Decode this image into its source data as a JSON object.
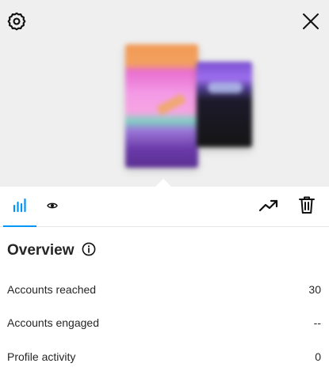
{
  "preview": {
    "settings_icon": "gear-icon",
    "close_icon": "close-icon",
    "colors": {
      "background": "#efefef"
    }
  },
  "tabs": [
    {
      "icon": "bar-chart-icon",
      "active": true
    },
    {
      "icon": "eye-icon",
      "active": false
    }
  ],
  "actions": [
    {
      "icon": "trending-up-icon"
    },
    {
      "icon": "trash-icon"
    }
  ],
  "overview": {
    "title": "Overview",
    "info_icon": "info-icon",
    "stats": [
      {
        "label": "Accounts reached",
        "value": "30"
      },
      {
        "label": "Accounts engaged",
        "value": "--"
      },
      {
        "label": "Profile activity",
        "value": "0"
      }
    ]
  },
  "colors": {
    "accent": "#0095f6",
    "text": "#262626",
    "divider": "#e6e6e6"
  }
}
